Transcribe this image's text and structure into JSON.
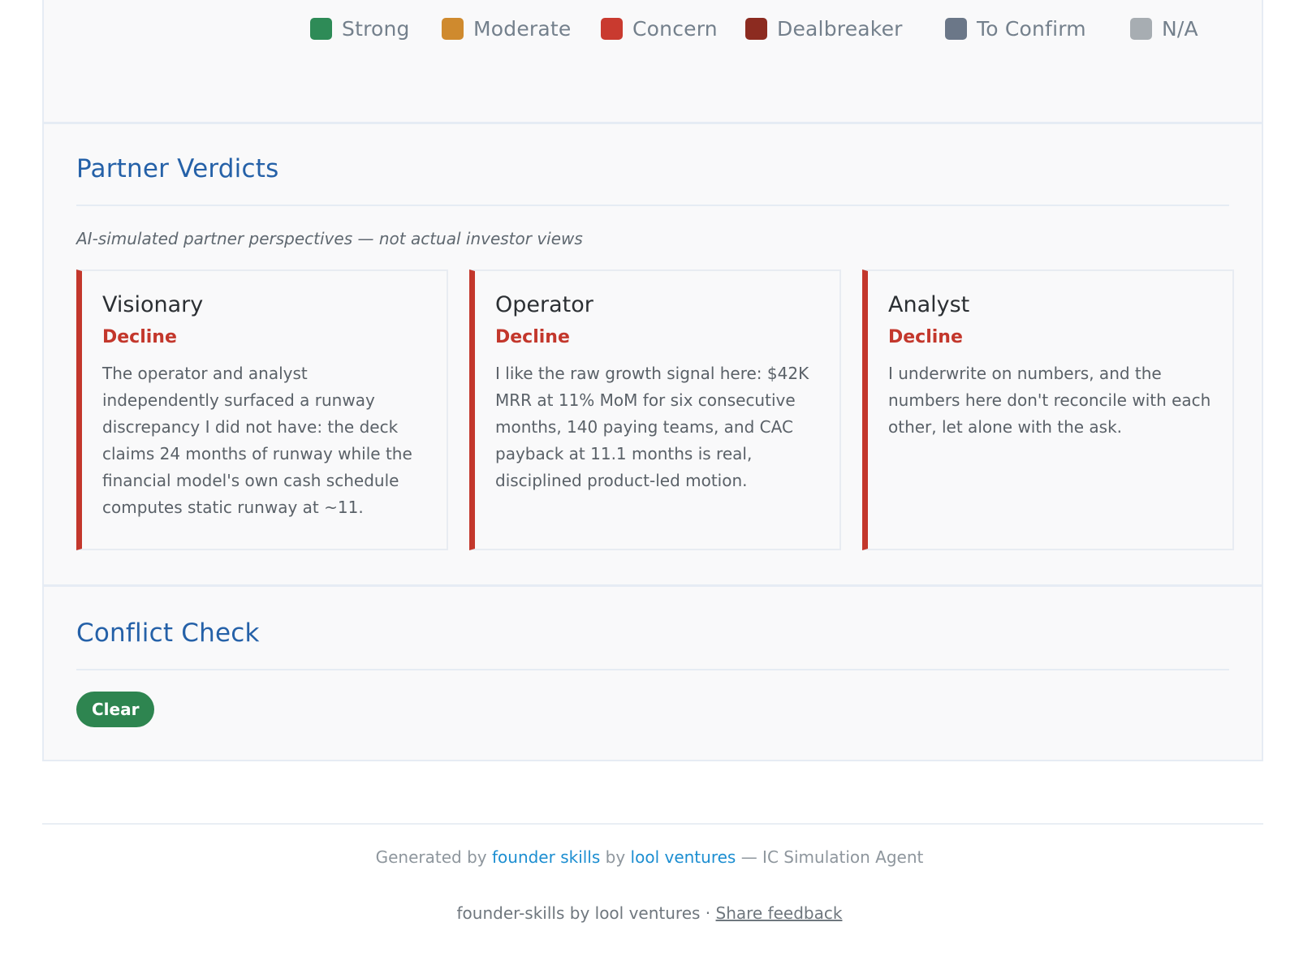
{
  "legend": [
    {
      "label": "Strong",
      "color": "#2e8b57"
    },
    {
      "label": "Moderate",
      "color": "#cf8a2e"
    },
    {
      "label": "Concern",
      "color": "#c93a2f"
    },
    {
      "label": "Dealbreaker",
      "color": "#8c2b20"
    },
    {
      "label": "To Confirm",
      "color": "#6b7788"
    },
    {
      "label": "N/A",
      "color": "#a7adb2"
    }
  ],
  "verdicts": {
    "title": "Partner Verdicts",
    "note": "AI-simulated partner perspectives — not actual investor views",
    "cards": [
      {
        "role": "Visionary",
        "verdict": "Decline",
        "text": "The operator and analyst independently surfaced a runway discrepancy I did not have: the deck claims 24 months of runway while the financial model's own cash schedule computes static runway at ~11."
      },
      {
        "role": "Operator",
        "verdict": "Decline",
        "text": "I like the raw growth signal here: $42K MRR at 11% MoM for six consecutive months, 140 paying teams, and CAC payback at 11.1 months is real, disciplined product-led motion."
      },
      {
        "role": "Analyst",
        "verdict": "Decline",
        "text": "I underwrite on numbers, and the numbers here don't reconcile with each other, let alone with the ask."
      }
    ]
  },
  "conflict": {
    "title": "Conflict Check",
    "status": "Clear"
  },
  "footer": {
    "generated_prefix": "Generated by",
    "generated_link1": "founder skills",
    "generated_mid": "by",
    "generated_link2": "lool ventures",
    "generated_suffix": "— IC Simulation Agent",
    "credit": "founder-skills by lool ventures ·",
    "feedback": "Share feedback"
  },
  "colors": {
    "accent": "#2561a8",
    "decline": "#c3372c",
    "clear": "#2e8550",
    "link": "#1c8ed1"
  }
}
